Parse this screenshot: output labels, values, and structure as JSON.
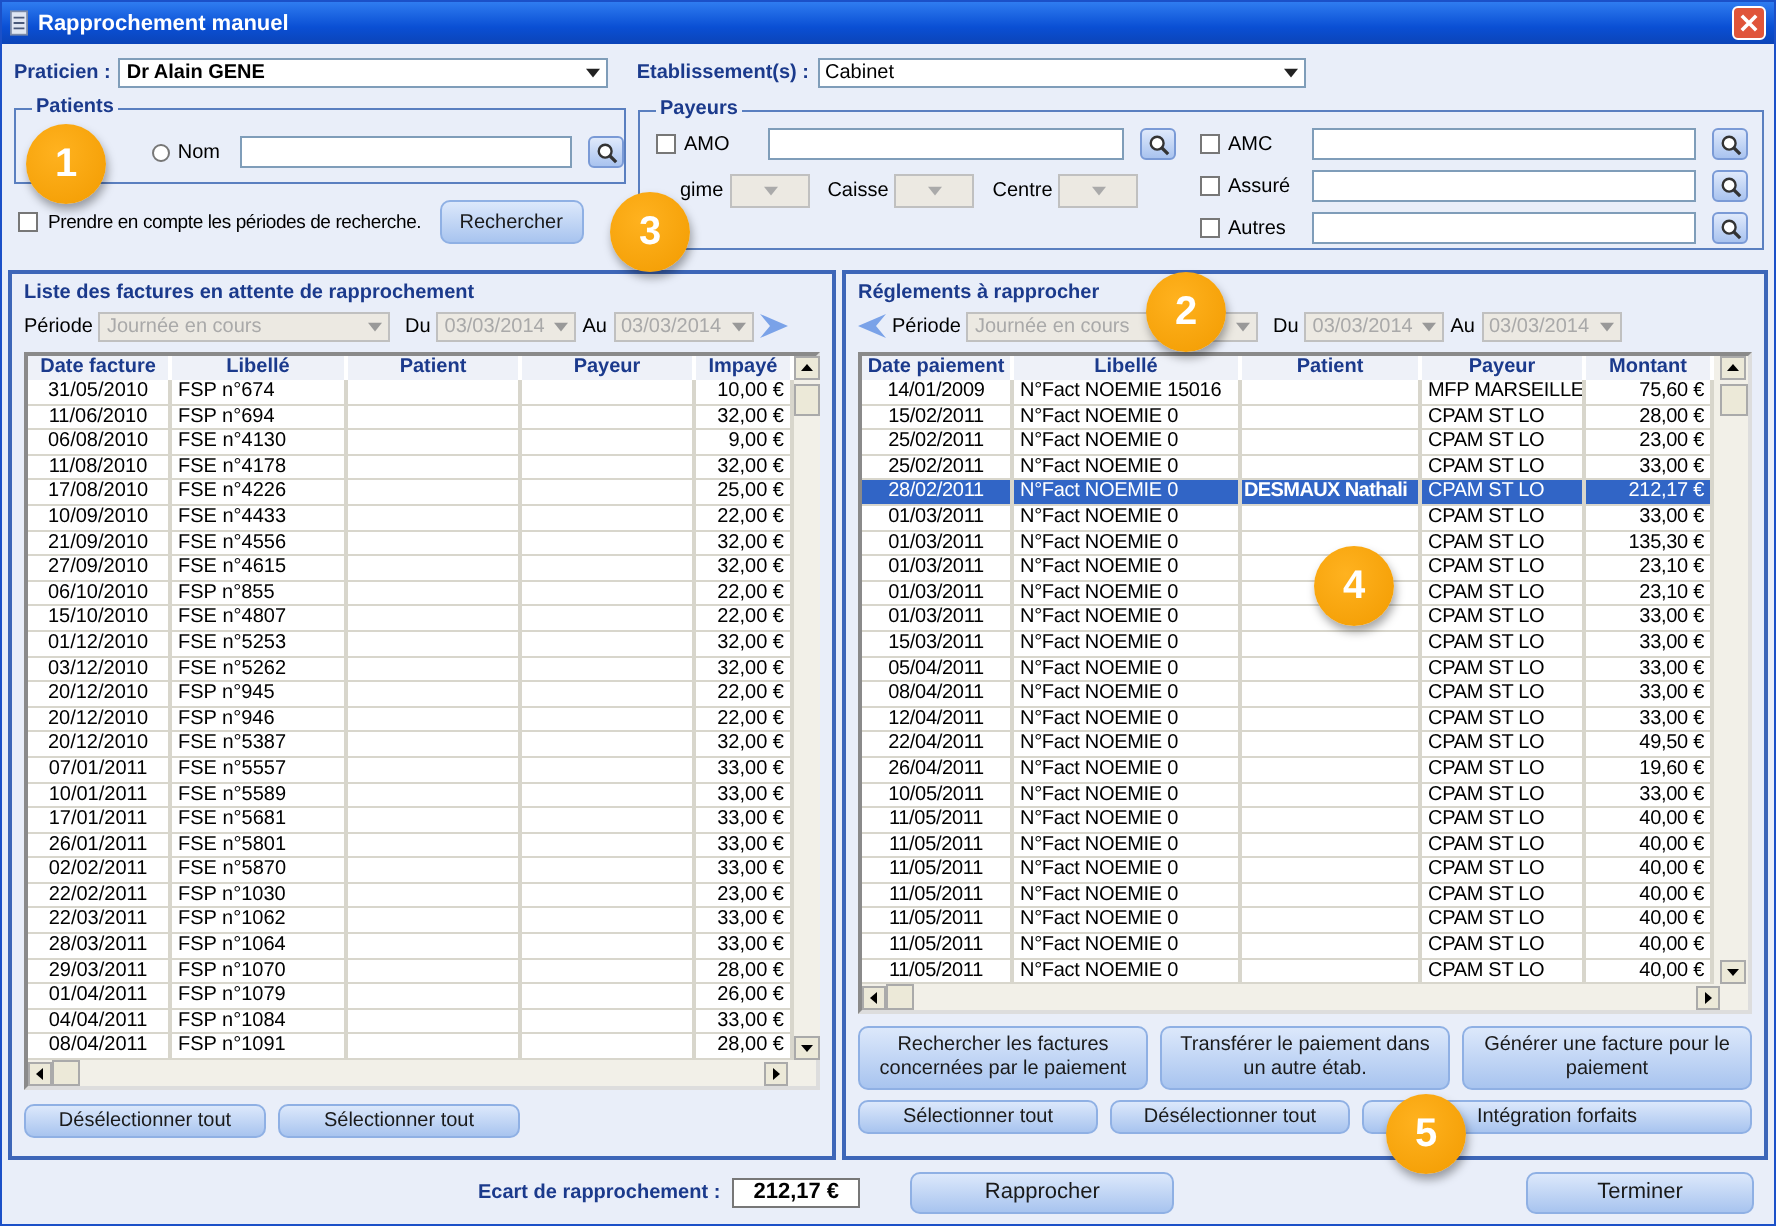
{
  "window": {
    "title": "Rapprochement manuel"
  },
  "praticien": {
    "label": "Praticien :",
    "value": "Dr Alain GENE"
  },
  "etablissement": {
    "label": "Etablissement(s) :",
    "value": "Cabinet"
  },
  "patients": {
    "title": "Patients",
    "nom_label": "Nom",
    "nom_selected": false
  },
  "periodes": {
    "label": "Prendre en compte les périodes de recherche.",
    "checked": false
  },
  "rechercher": "Rechercher",
  "payeurs": {
    "title": "Payeurs",
    "fields": [
      {
        "label": "AMO",
        "checked": false
      },
      {
        "label": "AMC",
        "checked": false
      },
      {
        "label": "Assuré",
        "checked": false
      },
      {
        "label": "Autres",
        "checked": false
      }
    ],
    "selects": [
      {
        "label": "gime",
        "disabled": true
      },
      {
        "label": "Caisse",
        "disabled": true
      },
      {
        "label": "Centre",
        "disabled": true
      }
    ]
  },
  "invoices": {
    "title": "Liste des factures en attente de rapprochement",
    "periode": {
      "label": "Période",
      "value": "Journée en cours",
      "disabled": true
    },
    "du": {
      "label": "Du",
      "value": "03/03/2014",
      "disabled": true
    },
    "au": {
      "label": "Au",
      "value": "03/03/2014",
      "disabled": true
    },
    "columns": [
      "Date facture",
      "Libellé",
      "Patient",
      "Payeur",
      "Impayé"
    ],
    "rows": [
      {
        "date": "31/05/2010",
        "libelle": "FSP n°674",
        "impaye": "10,00 €",
        "selected": false
      },
      {
        "date": "11/06/2010",
        "libelle": "FSP n°694",
        "impaye": "32,00 €",
        "selected": false
      },
      {
        "date": "06/08/2010",
        "libelle": "FSE n°4130",
        "impaye": "9,00 €",
        "selected": false
      },
      {
        "date": "11/08/2010",
        "libelle": "FSE n°4178",
        "impaye": "32,00 €",
        "selected": false
      },
      {
        "date": "17/08/2010",
        "libelle": "FSE n°4226",
        "impaye": "25,00 €",
        "selected": false
      },
      {
        "date": "10/09/2010",
        "libelle": "FSE n°4433",
        "impaye": "22,00 €",
        "selected": false
      },
      {
        "date": "21/09/2010",
        "libelle": "FSE n°4556",
        "impaye": "32,00 €",
        "selected": false
      },
      {
        "date": "27/09/2010",
        "libelle": "FSE n°4615",
        "impaye": "32,00 €",
        "selected": false
      },
      {
        "date": "06/10/2010",
        "libelle": "FSP n°855",
        "impaye": "22,00 €",
        "selected": false
      },
      {
        "date": "15/10/2010",
        "libelle": "FSE n°4807",
        "impaye": "22,00 €",
        "selected": false
      },
      {
        "date": "01/12/2010",
        "libelle": "FSE n°5253",
        "impaye": "32,00 €",
        "selected": false
      },
      {
        "date": "03/12/2010",
        "libelle": "FSE n°5262",
        "impaye": "32,00 €",
        "selected": false
      },
      {
        "date": "20/12/2010",
        "libelle": "FSP n°945",
        "impaye": "22,00 €",
        "selected": false
      },
      {
        "date": "20/12/2010",
        "libelle": "FSP n°946",
        "impaye": "22,00 €",
        "selected": false
      },
      {
        "date": "20/12/2010",
        "libelle": "FSE n°5387",
        "impaye": "32,00 €",
        "selected": false
      },
      {
        "date": "07/01/2011",
        "libelle": "FSE n°5557",
        "impaye": "33,00 €",
        "selected": false
      },
      {
        "date": "10/01/2011",
        "libelle": "FSE n°5589",
        "impaye": "33,00 €",
        "selected": false
      },
      {
        "date": "17/01/2011",
        "libelle": "FSE n°5681",
        "impaye": "33,00 €",
        "selected": false
      },
      {
        "date": "26/01/2011",
        "libelle": "FSE n°5801",
        "impaye": "33,00 €",
        "selected": false
      },
      {
        "date": "02/02/2011",
        "libelle": "FSE n°5870",
        "impaye": "33,00 €",
        "selected": false
      },
      {
        "date": "22/02/2011",
        "libelle": "FSP n°1030",
        "impaye": "23,00 €",
        "selected": false
      },
      {
        "date": "22/03/2011",
        "libelle": "FSP n°1062",
        "impaye": "33,00 €",
        "selected": false
      },
      {
        "date": "28/03/2011",
        "libelle": "FSP n°1064",
        "impaye": "33,00 €",
        "selected": false
      },
      {
        "date": "29/03/2011",
        "libelle": "FSP n°1070",
        "impaye": "28,00 €",
        "selected": false
      },
      {
        "date": "01/04/2011",
        "libelle": "FSP n°1079",
        "impaye": "26,00 €",
        "selected": false
      },
      {
        "date": "04/04/2011",
        "libelle": "FSP n°1084",
        "impaye": "33,00 €",
        "selected": false
      },
      {
        "date": "08/04/2011",
        "libelle": "FSP n°1091",
        "impaye": "28,00 €",
        "selected": false
      }
    ],
    "buttons": [
      "Désélectionner tout",
      "Sélectionner tout"
    ]
  },
  "payments": {
    "title": "Réglements à rapprocher",
    "periode": {
      "label": "Période",
      "value": "Journée en cours",
      "disabled": true
    },
    "du": {
      "label": "Du",
      "value": "03/03/2014",
      "disabled": true
    },
    "au": {
      "label": "Au",
      "value": "03/03/2014",
      "disabled": true
    },
    "columns": [
      "Date paiement",
      "Libellé",
      "Patient",
      "Payeur",
      "Montant"
    ],
    "rows": [
      {
        "date": "14/01/2009",
        "libelle": "N°Fact NOEMIE 15016",
        "payeur": "MFP  MARSEILLE",
        "montant": "75,60 €",
        "selected": false
      },
      {
        "date": "15/02/2011",
        "libelle": "N°Fact NOEMIE 0",
        "payeur": "CPAM ST LO",
        "montant": "28,00 €",
        "selected": false
      },
      {
        "date": "25/02/2011",
        "libelle": "N°Fact NOEMIE 0",
        "payeur": "CPAM ST LO",
        "montant": "23,00 €",
        "selected": false
      },
      {
        "date": "25/02/2011",
        "libelle": "N°Fact NOEMIE 0",
        "payeur": "CPAM ST LO",
        "montant": "33,00 €",
        "selected": false
      },
      {
        "date": "28/02/2011",
        "libelle": "N°Fact NOEMIE 0",
        "patient": "DESMAUX Nathali",
        "payeur": "CPAM ST LO",
        "montant": "212,17 €",
        "selected": true
      },
      {
        "date": "01/03/2011",
        "libelle": "N°Fact NOEMIE 0",
        "payeur": "CPAM ST LO",
        "montant": "33,00 €",
        "selected": false
      },
      {
        "date": "01/03/2011",
        "libelle": "N°Fact NOEMIE 0",
        "payeur": "CPAM ST LO",
        "montant": "135,30 €",
        "selected": false
      },
      {
        "date": "01/03/2011",
        "libelle": "N°Fact NOEMIE 0",
        "payeur": "CPAM ST LO",
        "montant": "23,10 €",
        "selected": false
      },
      {
        "date": "01/03/2011",
        "libelle": "N°Fact NOEMIE 0",
        "payeur": "CPAM ST LO",
        "montant": "23,10 €",
        "selected": false
      },
      {
        "date": "01/03/2011",
        "libelle": "N°Fact NOEMIE 0",
        "payeur": "CPAM ST LO",
        "montant": "33,00 €",
        "selected": false
      },
      {
        "date": "15/03/2011",
        "libelle": "N°Fact NOEMIE 0",
        "payeur": "CPAM ST LO",
        "montant": "33,00 €",
        "selected": false
      },
      {
        "date": "05/04/2011",
        "libelle": "N°Fact NOEMIE 0",
        "payeur": "CPAM ST LO",
        "montant": "33,00 €",
        "selected": false
      },
      {
        "date": "08/04/2011",
        "libelle": "N°Fact NOEMIE 0",
        "payeur": "CPAM ST LO",
        "montant": "33,00 €",
        "selected": false
      },
      {
        "date": "12/04/2011",
        "libelle": "N°Fact NOEMIE 0",
        "payeur": "CPAM ST LO",
        "montant": "33,00 €",
        "selected": false
      },
      {
        "date": "22/04/2011",
        "libelle": "N°Fact NOEMIE 0",
        "payeur": "CPAM ST LO",
        "montant": "49,50 €",
        "selected": false
      },
      {
        "date": "26/04/2011",
        "libelle": "N°Fact NOEMIE 0",
        "payeur": "CPAM ST LO",
        "montant": "19,60 €",
        "selected": false
      },
      {
        "date": "10/05/2011",
        "libelle": "N°Fact NOEMIE 0",
        "payeur": "CPAM ST LO",
        "montant": "33,00 €",
        "selected": false
      },
      {
        "date": "11/05/2011",
        "libelle": "N°Fact NOEMIE 0",
        "payeur": "CPAM ST LO",
        "montant": "40,00 €",
        "selected": false
      },
      {
        "date": "11/05/2011",
        "libelle": "N°Fact NOEMIE 0",
        "payeur": "CPAM ST LO",
        "montant": "40,00 €",
        "selected": false
      },
      {
        "date": "11/05/2011",
        "libelle": "N°Fact NOEMIE 0",
        "payeur": "CPAM ST LO",
        "montant": "40,00 €",
        "selected": false
      },
      {
        "date": "11/05/2011",
        "libelle": "N°Fact NOEMIE 0",
        "payeur": "CPAM ST LO",
        "montant": "40,00 €",
        "selected": false
      },
      {
        "date": "11/05/2011",
        "libelle": "N°Fact NOEMIE 0",
        "payeur": "CPAM ST LO",
        "montant": "40,00 €",
        "selected": false
      },
      {
        "date": "11/05/2011",
        "libelle": "N°Fact NOEMIE 0",
        "payeur": "CPAM ST LO",
        "montant": "40,00 €",
        "selected": false
      },
      {
        "date": "11/05/2011",
        "libelle": "N°Fact NOEMIE 0",
        "payeur": "CPAM ST LO",
        "montant": "40,00 €",
        "selected": false
      }
    ],
    "actions": [
      "Rechercher les factures concernées par le paiement",
      "Transférer le paiement dans un autre étab.",
      "Générer une facture pour le paiement"
    ],
    "buttons": [
      "Sélectionner tout",
      "Désélectionner tout",
      "Intégration forfaits"
    ]
  },
  "ecart": {
    "label": "Ecart de rapprochement :",
    "value": "212,17 €"
  },
  "buttons": [
    "Rapprocher",
    "Terminer"
  ],
  "callouts": [
    "1",
    "3",
    "2",
    "4",
    "5"
  ]
}
